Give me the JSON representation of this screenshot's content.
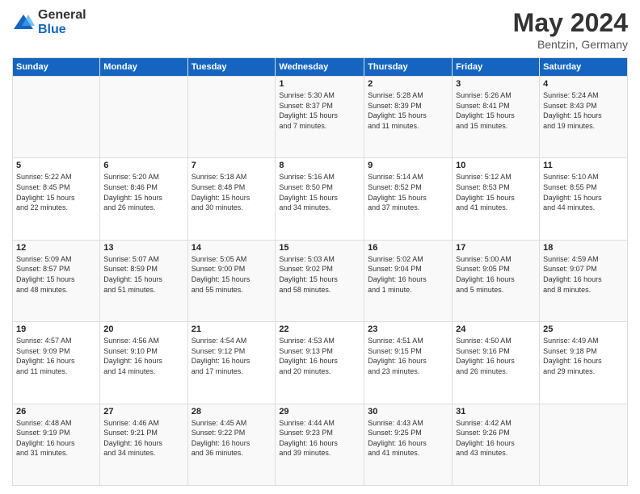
{
  "logo": {
    "general": "General",
    "blue": "Blue"
  },
  "title": "May 2024",
  "subtitle": "Bentzin, Germany",
  "headers": [
    "Sunday",
    "Monday",
    "Tuesday",
    "Wednesday",
    "Thursday",
    "Friday",
    "Saturday"
  ],
  "weeks": [
    [
      {
        "num": "",
        "info": ""
      },
      {
        "num": "",
        "info": ""
      },
      {
        "num": "",
        "info": ""
      },
      {
        "num": "1",
        "info": "Sunrise: 5:30 AM\nSunset: 8:37 PM\nDaylight: 15 hours\nand 7 minutes."
      },
      {
        "num": "2",
        "info": "Sunrise: 5:28 AM\nSunset: 8:39 PM\nDaylight: 15 hours\nand 11 minutes."
      },
      {
        "num": "3",
        "info": "Sunrise: 5:26 AM\nSunset: 8:41 PM\nDaylight: 15 hours\nand 15 minutes."
      },
      {
        "num": "4",
        "info": "Sunrise: 5:24 AM\nSunset: 8:43 PM\nDaylight: 15 hours\nand 19 minutes."
      }
    ],
    [
      {
        "num": "5",
        "info": "Sunrise: 5:22 AM\nSunset: 8:45 PM\nDaylight: 15 hours\nand 22 minutes."
      },
      {
        "num": "6",
        "info": "Sunrise: 5:20 AM\nSunset: 8:46 PM\nDaylight: 15 hours\nand 26 minutes."
      },
      {
        "num": "7",
        "info": "Sunrise: 5:18 AM\nSunset: 8:48 PM\nDaylight: 15 hours\nand 30 minutes."
      },
      {
        "num": "8",
        "info": "Sunrise: 5:16 AM\nSunset: 8:50 PM\nDaylight: 15 hours\nand 34 minutes."
      },
      {
        "num": "9",
        "info": "Sunrise: 5:14 AM\nSunset: 8:52 PM\nDaylight: 15 hours\nand 37 minutes."
      },
      {
        "num": "10",
        "info": "Sunrise: 5:12 AM\nSunset: 8:53 PM\nDaylight: 15 hours\nand 41 minutes."
      },
      {
        "num": "11",
        "info": "Sunrise: 5:10 AM\nSunset: 8:55 PM\nDaylight: 15 hours\nand 44 minutes."
      }
    ],
    [
      {
        "num": "12",
        "info": "Sunrise: 5:09 AM\nSunset: 8:57 PM\nDaylight: 15 hours\nand 48 minutes."
      },
      {
        "num": "13",
        "info": "Sunrise: 5:07 AM\nSunset: 8:59 PM\nDaylight: 15 hours\nand 51 minutes."
      },
      {
        "num": "14",
        "info": "Sunrise: 5:05 AM\nSunset: 9:00 PM\nDaylight: 15 hours\nand 55 minutes."
      },
      {
        "num": "15",
        "info": "Sunrise: 5:03 AM\nSunset: 9:02 PM\nDaylight: 15 hours\nand 58 minutes."
      },
      {
        "num": "16",
        "info": "Sunrise: 5:02 AM\nSunset: 9:04 PM\nDaylight: 16 hours\nand 1 minute."
      },
      {
        "num": "17",
        "info": "Sunrise: 5:00 AM\nSunset: 9:05 PM\nDaylight: 16 hours\nand 5 minutes."
      },
      {
        "num": "18",
        "info": "Sunrise: 4:59 AM\nSunset: 9:07 PM\nDaylight: 16 hours\nand 8 minutes."
      }
    ],
    [
      {
        "num": "19",
        "info": "Sunrise: 4:57 AM\nSunset: 9:09 PM\nDaylight: 16 hours\nand 11 minutes."
      },
      {
        "num": "20",
        "info": "Sunrise: 4:56 AM\nSunset: 9:10 PM\nDaylight: 16 hours\nand 14 minutes."
      },
      {
        "num": "21",
        "info": "Sunrise: 4:54 AM\nSunset: 9:12 PM\nDaylight: 16 hours\nand 17 minutes."
      },
      {
        "num": "22",
        "info": "Sunrise: 4:53 AM\nSunset: 9:13 PM\nDaylight: 16 hours\nand 20 minutes."
      },
      {
        "num": "23",
        "info": "Sunrise: 4:51 AM\nSunset: 9:15 PM\nDaylight: 16 hours\nand 23 minutes."
      },
      {
        "num": "24",
        "info": "Sunrise: 4:50 AM\nSunset: 9:16 PM\nDaylight: 16 hours\nand 26 minutes."
      },
      {
        "num": "25",
        "info": "Sunrise: 4:49 AM\nSunset: 9:18 PM\nDaylight: 16 hours\nand 29 minutes."
      }
    ],
    [
      {
        "num": "26",
        "info": "Sunrise: 4:48 AM\nSunset: 9:19 PM\nDaylight: 16 hours\nand 31 minutes."
      },
      {
        "num": "27",
        "info": "Sunrise: 4:46 AM\nSunset: 9:21 PM\nDaylight: 16 hours\nand 34 minutes."
      },
      {
        "num": "28",
        "info": "Sunrise: 4:45 AM\nSunset: 9:22 PM\nDaylight: 16 hours\nand 36 minutes."
      },
      {
        "num": "29",
        "info": "Sunrise: 4:44 AM\nSunset: 9:23 PM\nDaylight: 16 hours\nand 39 minutes."
      },
      {
        "num": "30",
        "info": "Sunrise: 4:43 AM\nSunset: 9:25 PM\nDaylight: 16 hours\nand 41 minutes."
      },
      {
        "num": "31",
        "info": "Sunrise: 4:42 AM\nSunset: 9:26 PM\nDaylight: 16 hours\nand 43 minutes."
      },
      {
        "num": "",
        "info": ""
      }
    ]
  ]
}
